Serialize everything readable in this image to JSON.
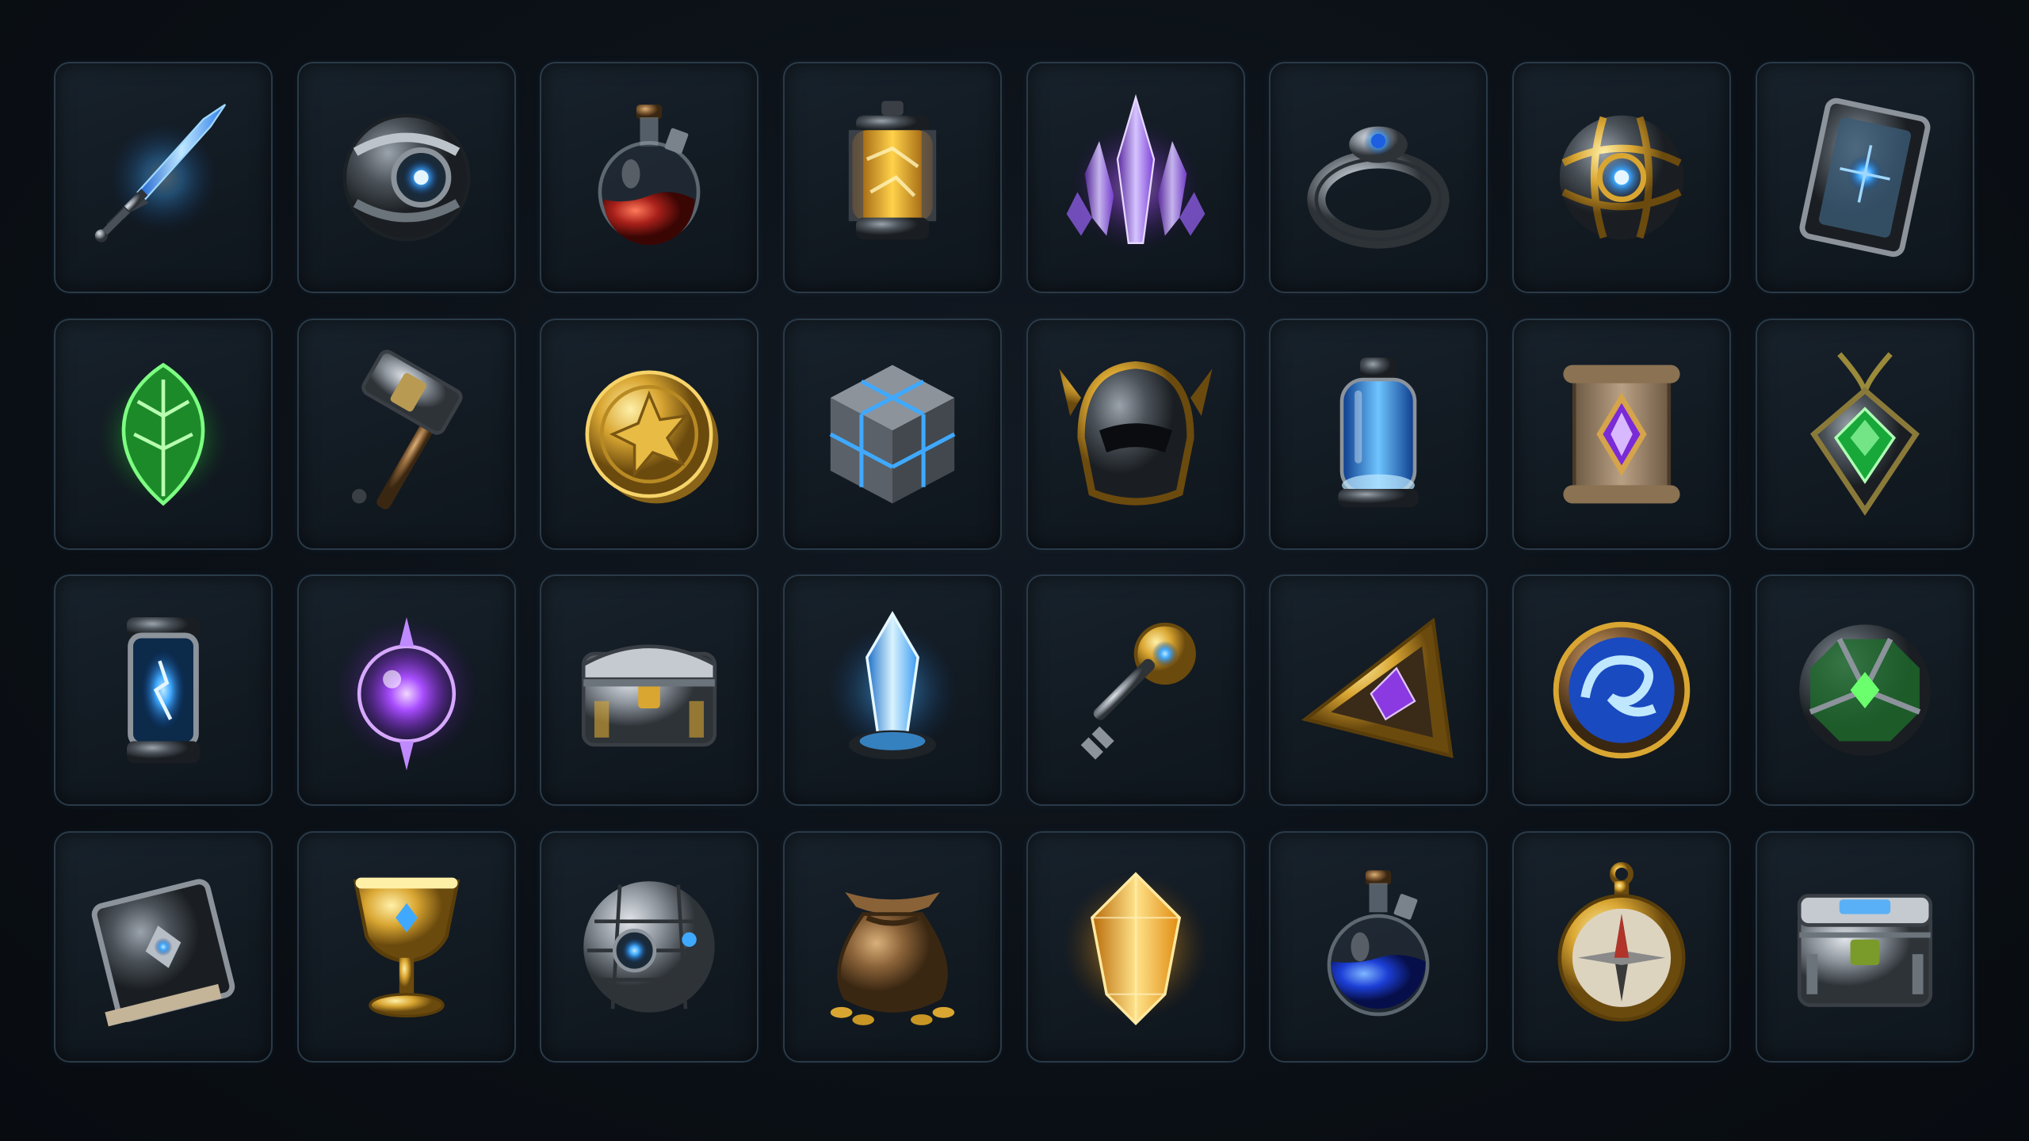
{
  "inventory": {
    "columns": 8,
    "rows": 4,
    "slots": [
      {
        "id": "blue-sword",
        "icon": "blue-sword-icon"
      },
      {
        "id": "tech-orb",
        "icon": "tech-orb-icon"
      },
      {
        "id": "red-potion",
        "icon": "red-potion-icon"
      },
      {
        "id": "amber-canister",
        "icon": "amber-canister-icon"
      },
      {
        "id": "purple-crystal",
        "icon": "purple-crystal-icon"
      },
      {
        "id": "sapphire-ring",
        "icon": "sapphire-ring-icon"
      },
      {
        "id": "gold-orb",
        "icon": "gold-orb-icon"
      },
      {
        "id": "rune-card",
        "icon": "rune-card-icon"
      },
      {
        "id": "green-leaf",
        "icon": "green-leaf-icon"
      },
      {
        "id": "war-hammer",
        "icon": "war-hammer-icon"
      },
      {
        "id": "gold-coin",
        "icon": "gold-coin-icon"
      },
      {
        "id": "stone-cube",
        "icon": "stone-cube-icon"
      },
      {
        "id": "gold-helmet",
        "icon": "gold-helmet-icon"
      },
      {
        "id": "blue-vial",
        "icon": "blue-vial-icon"
      },
      {
        "id": "scroll",
        "icon": "scroll-icon"
      },
      {
        "id": "emerald-amulet",
        "icon": "emerald-amulet-icon"
      },
      {
        "id": "energy-cell",
        "icon": "energy-cell-icon"
      },
      {
        "id": "purple-orb",
        "icon": "purple-orb-icon"
      },
      {
        "id": "silver-chest",
        "icon": "silver-chest-icon"
      },
      {
        "id": "ice-crystal",
        "icon": "ice-crystal-icon"
      },
      {
        "id": "ornate-key",
        "icon": "ornate-key-icon"
      },
      {
        "id": "triangle-amulet",
        "icon": "triangle-amulet-icon"
      },
      {
        "id": "swirl-shield",
        "icon": "swirl-shield-icon"
      },
      {
        "id": "green-orb",
        "icon": "green-orb-icon"
      },
      {
        "id": "spell-book",
        "icon": "spell-book-icon"
      },
      {
        "id": "gold-chalice",
        "icon": "gold-chalice-icon"
      },
      {
        "id": "stone-orb",
        "icon": "stone-orb-icon"
      },
      {
        "id": "coin-pouch",
        "icon": "coin-pouch-icon"
      },
      {
        "id": "amber-gem",
        "icon": "amber-gem-icon"
      },
      {
        "id": "blue-potion",
        "icon": "blue-potion-icon"
      },
      {
        "id": "compass",
        "icon": "compass-icon"
      },
      {
        "id": "tech-crate",
        "icon": "tech-crate-icon"
      }
    ]
  },
  "colors": {
    "background": "#0b1016",
    "slot_fill": "#141c24",
    "slot_border": "#2a3a48",
    "glow_blue": "#3fa9ff",
    "glow_purple": "#a84dff",
    "glow_green": "#38d84a",
    "gold": "#d9a632",
    "steel": "#8c939b",
    "potion_red": "#a8201a"
  }
}
